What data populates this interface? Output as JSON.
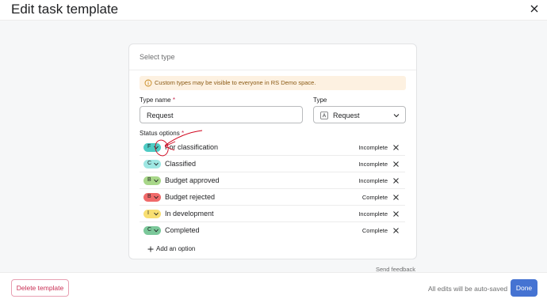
{
  "header": {
    "title": "Edit task template"
  },
  "card": {
    "section_title": "Select type",
    "notice": "Custom types may be visible to everyone in RS Demo space.",
    "type_name_label": "Type name",
    "required_mark": "*",
    "type_name_value": "Request",
    "type_label": "Type",
    "type_value": "Request",
    "status_options_label": "Status options",
    "statuses": [
      {
        "letter": "F",
        "name": "For classification",
        "state": "Incomplete",
        "color": "#4ecbc4"
      },
      {
        "letter": "C",
        "name": "Classified",
        "state": "Incomplete",
        "color": "#9ee7e3"
      },
      {
        "letter": "B",
        "name": "Budget approved",
        "state": "Incomplete",
        "color": "#a8d789"
      },
      {
        "letter": "B",
        "name": "Budget rejected",
        "state": "Complete",
        "color": "#f06a6a"
      },
      {
        "letter": "I",
        "name": "In development",
        "state": "Incomplete",
        "color": "#f8df72"
      },
      {
        "letter": "C",
        "name": "Completed",
        "state": "Complete",
        "color": "#7bc89a"
      }
    ],
    "add_option_label": "Add an option"
  },
  "send_feedback": "Send feedback",
  "footer": {
    "delete_label": "Delete template",
    "autosave_text": "All edits will be auto-saved",
    "done_label": "Done"
  },
  "colors": {
    "accent": "#4573d2",
    "danger": "#c92f54",
    "notice_bg": "#fdf1e1",
    "annotation": "#d0021b"
  },
  "icons": [
    "close-icon",
    "info-icon",
    "type-icon",
    "chevron-down-icon",
    "remove-icon",
    "plus-icon"
  ]
}
